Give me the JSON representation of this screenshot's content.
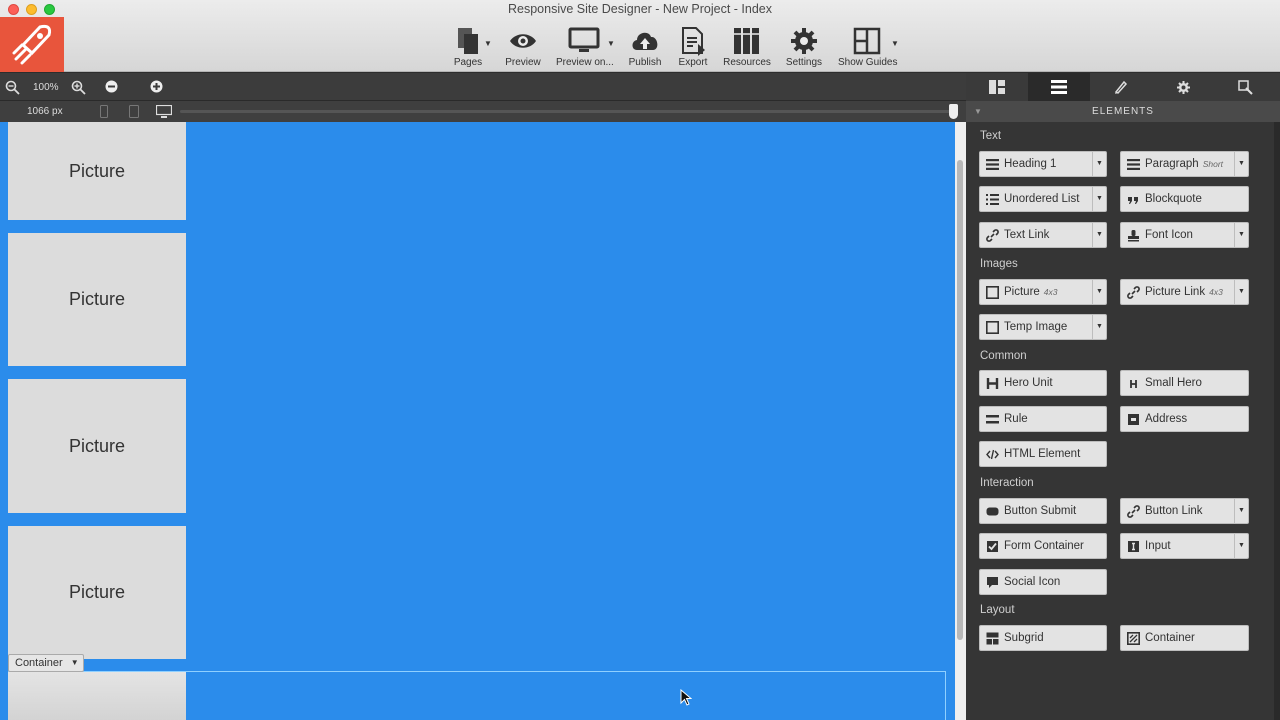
{
  "window": {
    "title": "Responsive Site Designer - New Project - Index"
  },
  "toolbar": {
    "pages": "Pages",
    "preview": "Preview",
    "preview_on": "Preview on...",
    "publish": "Publish",
    "export": "Export",
    "resources": "Resources",
    "settings": "Settings",
    "show_guides": "Show Guides"
  },
  "canvas_controls": {
    "zoom_level": "100%",
    "width_readout": "1066 px"
  },
  "canvas": {
    "pictures": [
      "Picture",
      "Picture",
      "Picture",
      "Picture"
    ],
    "container_tag": "Container",
    "background_color": "#2b8ceb"
  },
  "panel": {
    "header": "ELEMENTS",
    "sections": {
      "text": "Text",
      "images": "Images",
      "common": "Common",
      "interaction": "Interaction",
      "layout": "Layout"
    },
    "elements": {
      "heading_1": "Heading 1",
      "paragraph": "Paragraph",
      "paragraph_variant": "Short",
      "unordered_list": "Unordered List",
      "blockquote": "Blockquote",
      "text_link": "Text Link",
      "font_icon": "Font Icon",
      "picture": "Picture",
      "picture_variant": "4x3",
      "picture_link": "Picture Link",
      "picture_link_variant": "4x3",
      "temp_image": "Temp Image",
      "hero_unit": "Hero Unit",
      "small_hero": "Small Hero",
      "rule": "Rule",
      "address": "Address",
      "html_element": "HTML Element",
      "button_submit": "Button Submit",
      "button_link": "Button Link",
      "form_container": "Form Container",
      "input": "Input",
      "social_icon": "Social Icon",
      "subgrid": "Subgrid",
      "container": "Container"
    }
  }
}
